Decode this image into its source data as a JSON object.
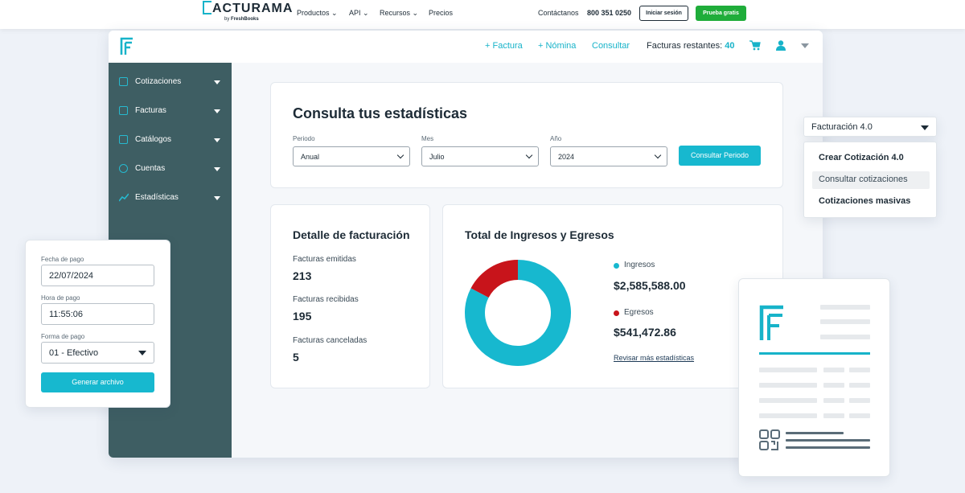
{
  "site": {
    "logo_text": "ACTURAMA",
    "logo_by": "by",
    "logo_brand": "FreshBooks",
    "nav": [
      "Productos",
      "API",
      "Recursos",
      "Precios"
    ],
    "contact_label": "Contáctanos",
    "phone": "800 351 0250",
    "login_label": "Iniciar sesión",
    "trial_label": "Prueba gratis"
  },
  "app": {
    "header": {
      "factura": "+ Factura",
      "nomina": "+ Nómina",
      "consultar": "Consultar",
      "remaining_label": "Facturas restantes:",
      "remaining_count": "40"
    },
    "sidebar": {
      "items": [
        {
          "label": "Cotizaciones"
        },
        {
          "label": "Facturas"
        },
        {
          "label": "Catálogos"
        },
        {
          "label": "Cuentas"
        },
        {
          "label": "Estadísticas"
        }
      ]
    },
    "query": {
      "title": "Consulta tus estadísticas",
      "periodo_label": "Periodo",
      "periodo_value": "Anual",
      "mes_label": "Mes",
      "mes_value": "Julio",
      "anio_label": "Año",
      "anio_value": "2024",
      "button": "Consultar Periodo"
    },
    "detail": {
      "title": "Detalle de facturación",
      "emitidas_label": "Facturas emitidas",
      "emitidas_value": "213",
      "recibidas_label": "Facturas recibidas",
      "recibidas_value": "195",
      "canceladas_label": "Facturas canceladas",
      "canceladas_value": "5"
    },
    "totals": {
      "title": "Total de Ingresos y Egresos",
      "ingresos_label": "Ingresos",
      "ingresos_value": "$2,585,588.00",
      "egresos_label": "Egresos",
      "egresos_value": "$541,472.86",
      "link": "Revisar más estadísticas",
      "colors": {
        "ingresos": "#17b8cf",
        "egresos": "#c8141b"
      }
    }
  },
  "chart_data": {
    "type": "pie",
    "categories": [
      "Ingresos",
      "Egresos"
    ],
    "values": [
      2585588.0,
      541472.86
    ]
  },
  "dropdown_menu": {
    "selected": "Facturación 4.0",
    "items": [
      "Crear Cotización 4.0",
      "Consultar cotizaciones",
      "Cotizaciones masivas"
    ]
  },
  "payment": {
    "fecha_label": "Fecha de pago",
    "fecha_value": "22/07/2024",
    "hora_label": "Hora de pago",
    "hora_value": "11:55:06",
    "forma_label": "Forma de pago",
    "forma_value": "01 - Efectivo",
    "button": "Generar archivo"
  }
}
